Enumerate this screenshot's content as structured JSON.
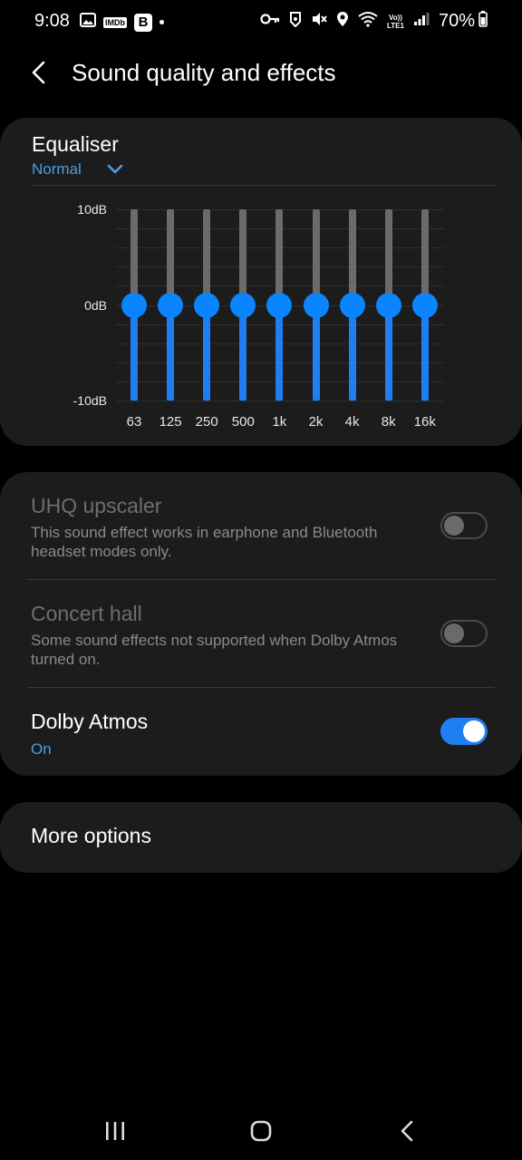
{
  "status_bar": {
    "time": "9:08",
    "left_icons": [
      "gallery-icon",
      "imdb-icon",
      "b-app-icon",
      "dot-icon"
    ],
    "imdb_text": "IMDb",
    "b_text": "B",
    "right_icons": [
      "vpn-key-icon",
      "shield-app-icon",
      "mute-icon",
      "location-icon",
      "wifi-icon",
      "volte-icon",
      "signal-icon",
      "battery-icon"
    ],
    "volte_line1": "Vo))",
    "volte_line2": "LTE1",
    "battery": "70%"
  },
  "header": {
    "back_icon": "chevron-left-icon",
    "title": "Sound quality and effects"
  },
  "equaliser": {
    "title": "Equaliser",
    "preset": "Normal",
    "preset_icon": "chevron-down-icon",
    "db_labels": {
      "top": "10dB",
      "mid": "0dB",
      "bottom": "-10dB"
    },
    "bands": [
      {
        "freq": "63",
        "gain_db": 0
      },
      {
        "freq": "125",
        "gain_db": 0
      },
      {
        "freq": "250",
        "gain_db": 0
      },
      {
        "freq": "500",
        "gain_db": 0
      },
      {
        "freq": "1k",
        "gain_db": 0
      },
      {
        "freq": "2k",
        "gain_db": 0
      },
      {
        "freq": "4k",
        "gain_db": 0
      },
      {
        "freq": "8k",
        "gain_db": 0
      },
      {
        "freq": "16k",
        "gain_db": 0
      }
    ],
    "range_db": [
      -10,
      10
    ],
    "accent_color": "#0a84ff"
  },
  "effects": {
    "uhq": {
      "title": "UHQ upscaler",
      "description": "This sound effect works in earphone and Bluetooth headset modes only.",
      "enabled": false,
      "available": false
    },
    "concert_hall": {
      "title": "Concert hall",
      "description": "Some sound effects not supported when Dolby Atmos turned on.",
      "enabled": false,
      "available": false
    },
    "dolby": {
      "title": "Dolby Atmos",
      "state": "On",
      "enabled": true
    }
  },
  "more_options": {
    "label": "More options"
  },
  "nav_bar": {
    "icons": [
      "recent-apps-icon",
      "home-icon",
      "back-icon"
    ]
  }
}
